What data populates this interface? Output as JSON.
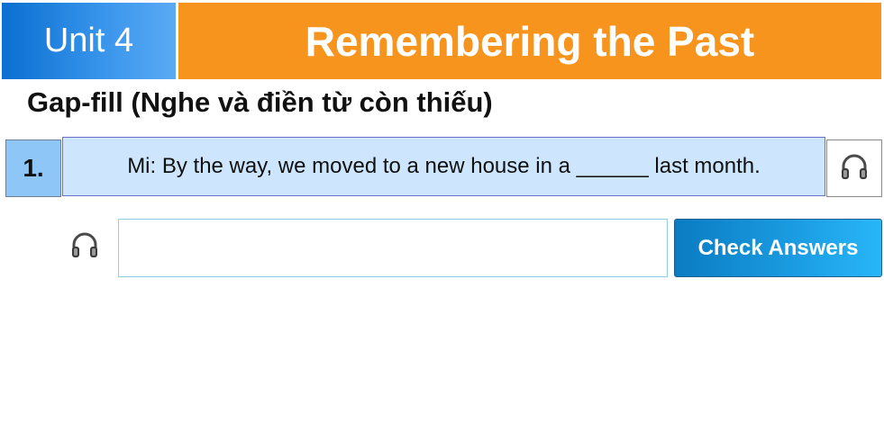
{
  "header": {
    "unit_label": "Unit 4",
    "title": "Remembering the Past"
  },
  "exercise": {
    "subtitle": "Gap-fill (Nghe và điền từ còn thiếu)"
  },
  "question": {
    "number": "1.",
    "sentence": "Mi: By the way, we moved to a new house in a ______ last month."
  },
  "answer": {
    "value": "",
    "placeholder": ""
  },
  "buttons": {
    "check_label": "Check Answers"
  },
  "icons": {
    "audio_top": "headphones-icon",
    "audio_bottom": "headphones-icon"
  },
  "colors": {
    "unit_blue": "#0a6fd0",
    "title_orange": "#f7941e",
    "sentence_bg": "#cde6fd",
    "number_bg": "#8ec6f7",
    "button_blue": "#1a9ae0"
  }
}
